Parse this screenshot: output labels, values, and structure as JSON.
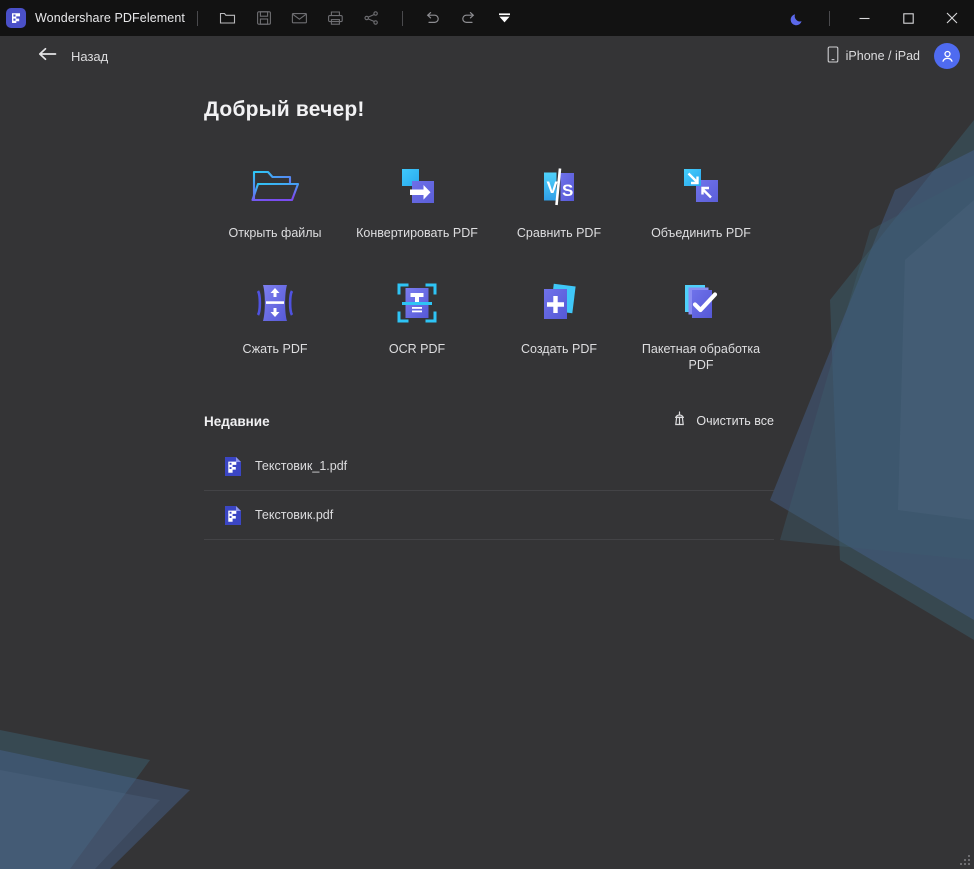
{
  "window": {
    "app_title": "Wondershare PDFelement",
    "logo_icon": "pdfelement-logo-icon",
    "toolbar_icons": [
      {
        "name": "open-folder-icon",
        "label": "Open"
      },
      {
        "name": "save-icon",
        "label": "Save"
      },
      {
        "name": "mail-icon",
        "label": "Email"
      },
      {
        "name": "print-icon",
        "label": "Print"
      },
      {
        "name": "share-icon",
        "label": "Share"
      },
      {
        "name": "undo-icon",
        "label": "Undo"
      },
      {
        "name": "redo-icon",
        "label": "Redo"
      },
      {
        "name": "more-dropdown-icon",
        "label": "More"
      }
    ],
    "theme_toggle_icon": "moon-icon",
    "minimize_icon": "minimize-icon",
    "maximize_icon": "maximize-icon",
    "close_icon": "close-icon"
  },
  "nav": {
    "back_icon": "arrow-left-icon",
    "back_label": "Назад",
    "device_icon": "phone-icon",
    "device_label": "iPhone / iPad",
    "avatar_icon": "user-avatar-icon"
  },
  "main": {
    "greeting": "Добрый вечер!",
    "tiles": [
      {
        "id": "open-files",
        "label": "Открыть файлы",
        "icon": "open-folder-icon"
      },
      {
        "id": "convert-pdf",
        "label": "Конвертировать PDF",
        "icon": "convert-pdf-icon"
      },
      {
        "id": "compare-pdf",
        "label": "Сравнить PDF",
        "icon": "compare-pdf-icon"
      },
      {
        "id": "merge-pdf",
        "label": "Объединить PDF",
        "icon": "merge-pdf-icon"
      },
      {
        "id": "compress-pdf",
        "label": "Сжать PDF",
        "icon": "compress-pdf-icon"
      },
      {
        "id": "ocr-pdf",
        "label": "OCR PDF",
        "icon": "ocr-pdf-icon"
      },
      {
        "id": "create-pdf",
        "label": "Создать PDF",
        "icon": "create-pdf-icon"
      },
      {
        "id": "batch-pdf",
        "label": "Пакетная обработка PDF",
        "icon": "batch-pdf-icon"
      }
    ],
    "recent": {
      "title": "Недавние",
      "clear_all_label": "Очистить все",
      "clear_all_icon": "broom-icon",
      "files": [
        {
          "name": "Текстовик_1.pdf",
          "icon": "pdf-file-icon"
        },
        {
          "name": "Текстовик.pdf",
          "icon": "pdf-file-icon"
        }
      ]
    }
  },
  "colors": {
    "titlebar_bg": "#121212",
    "app_bg": "#343436",
    "accent_blue": "#4f6bf0",
    "logo_bg": "#4a50c8",
    "text_primary": "#e8e8ea",
    "divider": "#434346"
  }
}
